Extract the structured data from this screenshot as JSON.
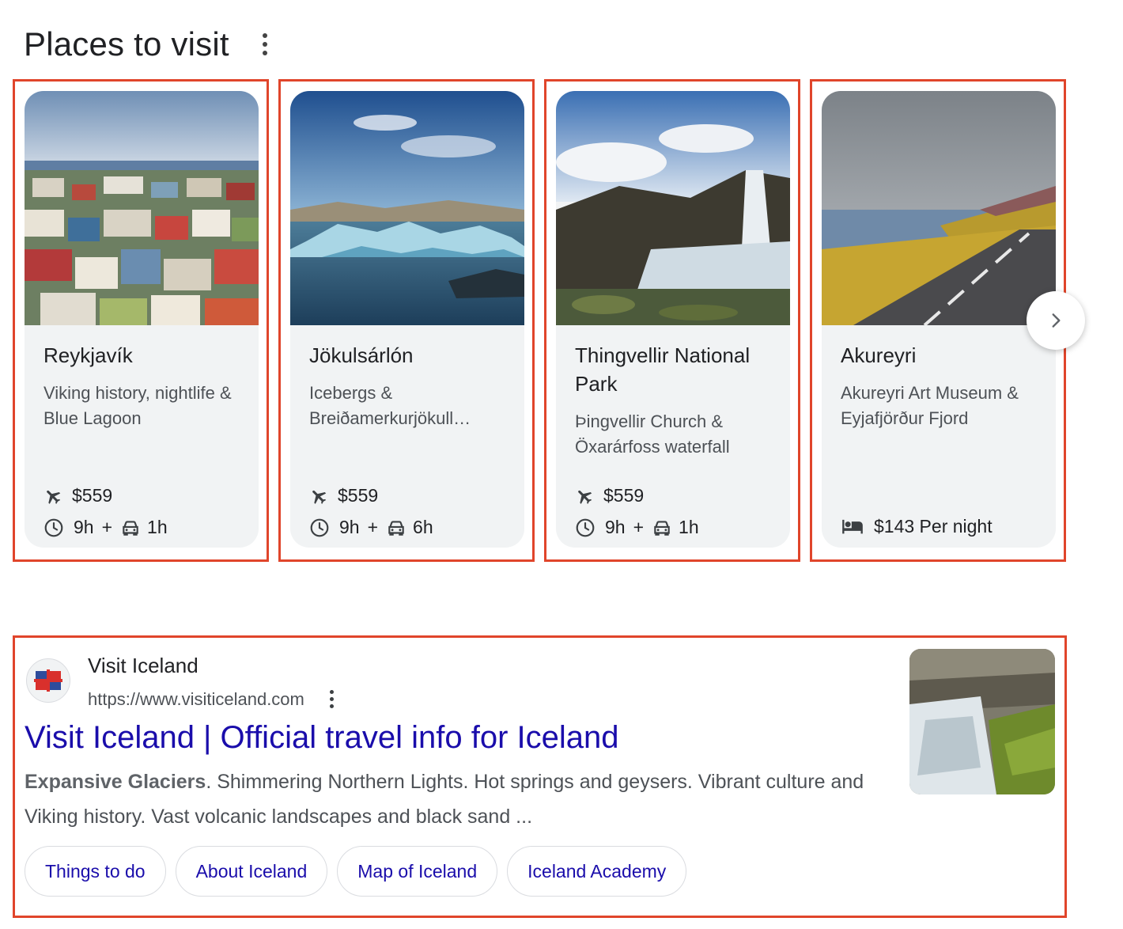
{
  "section": {
    "title": "Places to visit",
    "menu_icon": "more-vert-icon"
  },
  "places": [
    {
      "name": "Reykjavík",
      "description": "Viking history, nightlife & Blue Lagoon",
      "flight_price": "$559",
      "flight_time": "9h",
      "plus": "+",
      "drive_time": "1h",
      "image_desc": "colorful city rooftops by the sea"
    },
    {
      "name": "Jökulsárlón",
      "description": "Icebergs & Breiðamerkurjökull…",
      "flight_price": "$559",
      "flight_time": "9h",
      "plus": "+",
      "drive_time": "6h",
      "image_desc": "glacier lagoon with icebergs"
    },
    {
      "name": "Thingvellir National Park",
      "description": "Þingvellir Church & Öxarárfoss waterfall",
      "flight_price": "$559",
      "flight_time": "9h",
      "plus": "+",
      "drive_time": "1h",
      "image_desc": "waterfall over mossy rocks"
    },
    {
      "name": "Akureyri",
      "description": "Akureyri Art Museum & Eyjafjörður Fjord",
      "hotel_price": "$143 Per night",
      "image_desc": "road along a fjord"
    }
  ],
  "carousel": {
    "next_icon": "chevron-right-icon"
  },
  "result": {
    "site_name": "Visit Iceland",
    "url": "https://www.visiticeland.com",
    "title": "Visit Iceland | Official travel info for Iceland",
    "snippet_bold": "Expansive Glaciers",
    "snippet_rest": ". Shimmering Northern Lights. Hot springs and geysers. Vibrant culture and Viking history. Vast volcanic landscapes and black sand ...",
    "chips": [
      "Things to do",
      "About Iceland",
      "Map of Iceland",
      "Iceland Academy"
    ]
  },
  "colors": {
    "highlight_border": "#e0452b",
    "link": "#1a0dab",
    "card_bg": "#f1f3f4",
    "text_secondary": "#4d5156"
  }
}
